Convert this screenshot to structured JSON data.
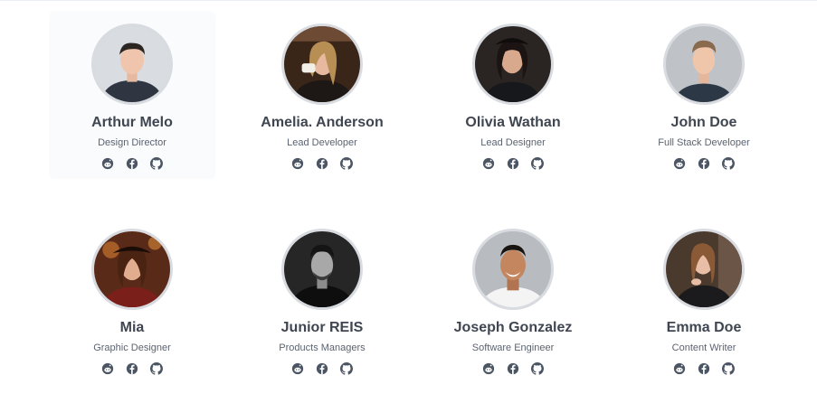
{
  "team": [
    {
      "name": "Arthur Melo",
      "role": "Design Director",
      "icons": [
        "reddit-icon",
        "facebook-icon",
        "github-icon"
      ]
    },
    {
      "name": "Amelia. Anderson",
      "role": "Lead Developer",
      "icons": [
        "reddit-icon",
        "facebook-icon",
        "github-icon"
      ]
    },
    {
      "name": "Olivia Wathan",
      "role": "Lead Designer",
      "icons": [
        "reddit-icon",
        "facebook-icon",
        "github-icon"
      ]
    },
    {
      "name": "John Doe",
      "role": "Full Stack Developer",
      "icons": [
        "reddit-icon",
        "facebook-icon",
        "github-icon"
      ]
    },
    {
      "name": "Mia",
      "role": "Graphic Designer",
      "icons": [
        "reddit-icon",
        "facebook-icon",
        "github-icon"
      ]
    },
    {
      "name": "Junior REIS",
      "role": "Products Managers",
      "icons": [
        "reddit-icon",
        "facebook-icon",
        "github-icon"
      ]
    },
    {
      "name": "Joseph Gonzalez",
      "role": "Software Engineer",
      "icons": [
        "reddit-icon",
        "facebook-icon",
        "github-icon"
      ]
    },
    {
      "name": "Emma Doe",
      "role": "Content Writer",
      "icons": [
        "reddit-icon",
        "facebook-icon",
        "github-icon"
      ]
    }
  ],
  "colors": {
    "name_text": "#3f4651",
    "role_text": "#5b6370",
    "icon": "#4b5563",
    "avatar_border": "#d8dbe0"
  }
}
